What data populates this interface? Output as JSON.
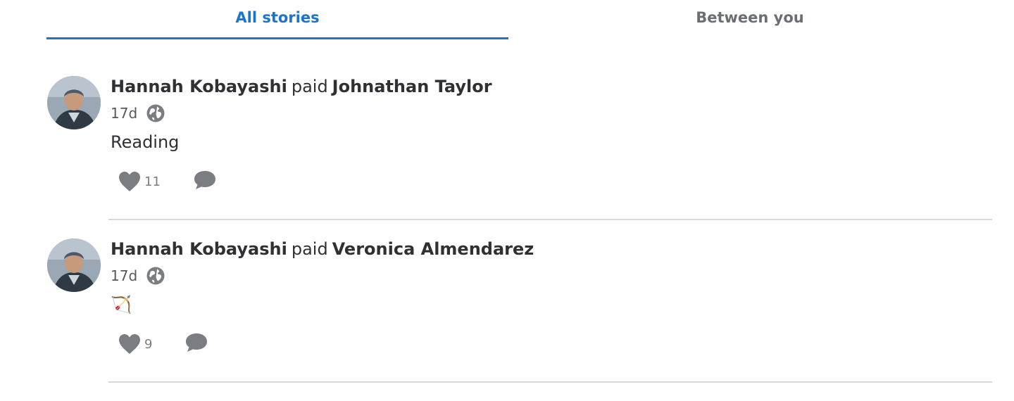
{
  "tabs": [
    {
      "label": "All stories",
      "active": true
    },
    {
      "label": "Between you",
      "active": false
    }
  ],
  "colors": {
    "accent": "#1b74d0",
    "muted": "#6b6e73",
    "icon": "#7a7d82"
  },
  "stories": [
    {
      "actor": "Hannah Kobayashi",
      "verb": "paid",
      "target": "Johnathan Taylor",
      "time": "17d",
      "audience_icon": "globe-icon",
      "note": "Reading",
      "likes": "11"
    },
    {
      "actor": "Hannah Kobayashi",
      "verb": "paid",
      "target": "Veronica Almendarez",
      "time": "17d",
      "audience_icon": "globe-icon",
      "note": "🏹",
      "likes": "9"
    }
  ]
}
